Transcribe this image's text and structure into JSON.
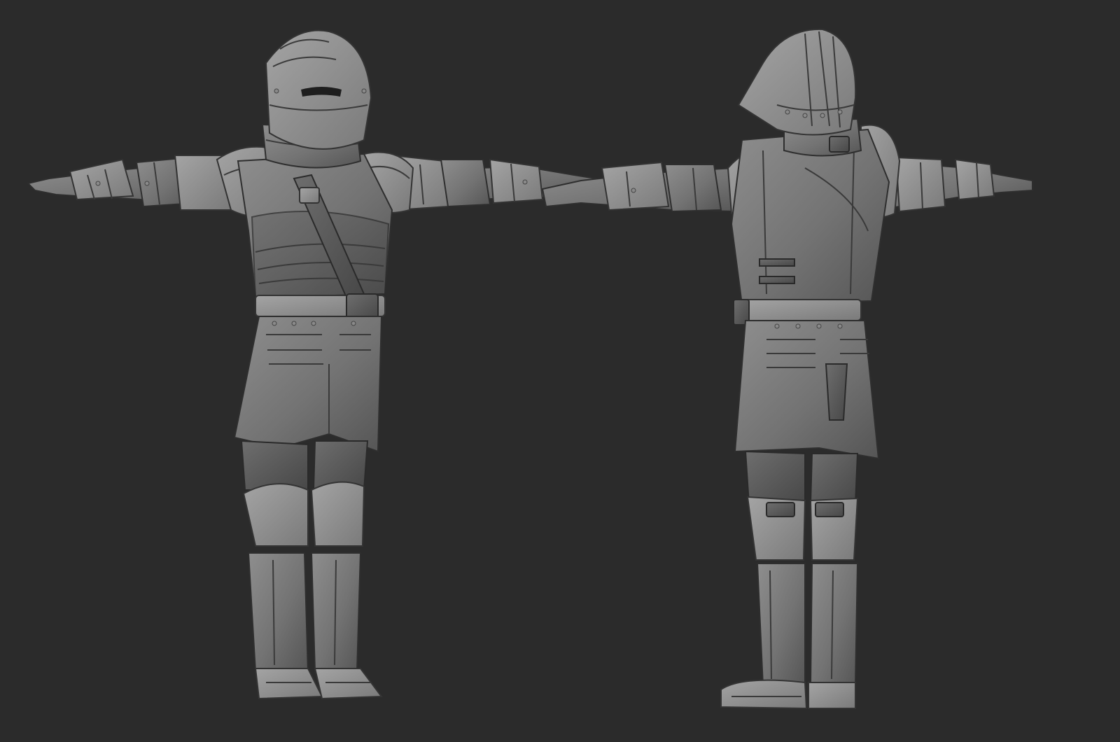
{
  "viewport": {
    "background_color": "#2b2b2b",
    "material_color": "#7a7a7a"
  },
  "models": [
    {
      "view": "front-three-quarter",
      "subject": "armored-knight"
    },
    {
      "view": "back-three-quarter",
      "subject": "armored-knight"
    }
  ]
}
